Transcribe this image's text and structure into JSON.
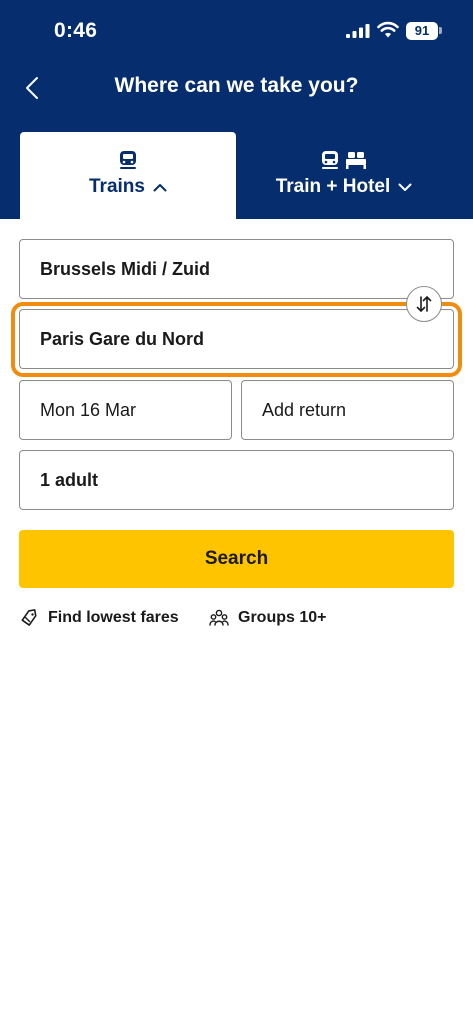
{
  "status_bar": {
    "time": "0:46",
    "battery": "91",
    "icons": [
      "signal-icon",
      "wifi-icon",
      "battery-icon"
    ]
  },
  "header": {
    "title": "Where can we take you?",
    "back_icon": "chevron-left-icon"
  },
  "tabs": [
    {
      "label": "Trains",
      "icons": [
        "train-icon"
      ],
      "chevron": "chevron-up-icon",
      "selected": true
    },
    {
      "label": "Train + Hotel",
      "icons": [
        "train-icon",
        "bed-icon"
      ],
      "chevron": "chevron-down-icon",
      "selected": false
    }
  ],
  "form": {
    "origin": "Brussels Midi / Zuid",
    "destination": "Paris Gare du Nord",
    "outbound_date": "Mon 16 Mar",
    "return_placeholder": "Add return",
    "passengers": "1 adult",
    "swap_icon": "swap-vertical-icon",
    "focused_field": "destination"
  },
  "search_button": {
    "label": "Search"
  },
  "links": [
    {
      "label": "Find lowest fares",
      "icon": "ticket-tag-icon"
    },
    {
      "label": "Groups 10+",
      "icon": "group-icon"
    }
  ],
  "colors": {
    "brand_navy": "#062e6f",
    "accent_yellow": "#ffc400",
    "focus_orange": "#f28c0f",
    "field_border": "#8c8c8c"
  }
}
